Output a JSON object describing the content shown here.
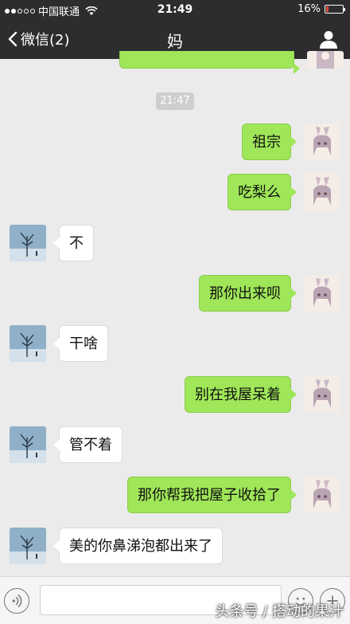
{
  "status_bar": {
    "carrier": "中国联通",
    "time": "21:49",
    "battery_percent": "16%",
    "battery_level": 0.16,
    "signal_dots_filled": 2,
    "signal_dots_total": 5
  },
  "nav": {
    "back_label": "微信(2)",
    "title": "妈",
    "back_icon": "chevron-left-icon",
    "profile_icon": "person-icon"
  },
  "chat": {
    "timestamp": "21:47",
    "messages": [
      {
        "side": "out",
        "text": "祖宗"
      },
      {
        "side": "out",
        "text": "吃梨么"
      },
      {
        "side": "in",
        "text": "不"
      },
      {
        "side": "out",
        "text": "那你出来呗"
      },
      {
        "side": "in",
        "text": "干啥"
      },
      {
        "side": "out",
        "text": "别在我屋呆着"
      },
      {
        "side": "in",
        "text": "管不着"
      },
      {
        "side": "out",
        "text": "那你帮我把屋子收拾了"
      },
      {
        "side": "in",
        "text": "美的你鼻涕泡都出来了"
      }
    ]
  },
  "input_bar": {
    "voice_icon": "voice-icon",
    "emoji_icon": "emoji-icon",
    "plus_icon": "plus-icon"
  },
  "watermark": "头条号 / 搭动的果汁",
  "colors": {
    "bar_bg": "#2d2d2f",
    "chat_bg": "#ebebeb",
    "outgoing_bubble": "#9fe658",
    "incoming_bubble": "#ffffff"
  }
}
